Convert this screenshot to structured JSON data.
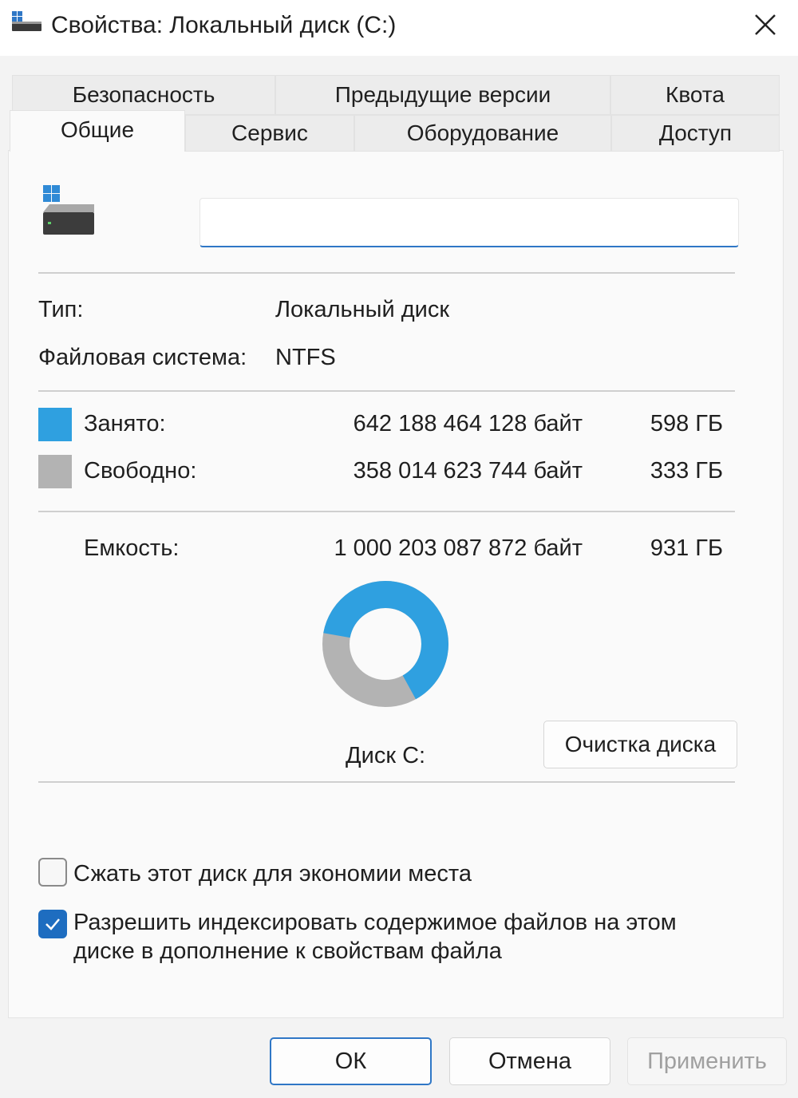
{
  "window": {
    "title": "Свойства: Локальный диск (C:)",
    "close_icon": "close-icon",
    "title_icon": "drive-icon"
  },
  "tabs": {
    "row_top": [
      {
        "label": "Безопасность"
      },
      {
        "label": "Предыдущие версии"
      },
      {
        "label": "Квота"
      }
    ],
    "row_bottom": [
      {
        "label": "Общие",
        "active": true
      },
      {
        "label": "Сервис"
      },
      {
        "label": "Оборудование"
      },
      {
        "label": "Доступ"
      }
    ]
  },
  "general": {
    "drive_name_value": "",
    "type_label": "Тип:",
    "type_value": "Локальный диск",
    "fs_label": "Файловая система:",
    "fs_value": "NTFS",
    "used": {
      "label": "Занято:",
      "bytes": "642 188 464 128 байт",
      "size": "598 ГБ",
      "color": "#2fa0e0"
    },
    "free": {
      "label": "Свободно:",
      "bytes": "358 014 623 744 байт",
      "size": "333 ГБ",
      "color": "#b3b3b3"
    },
    "capacity": {
      "label": "Емкость:",
      "bytes": "1 000 203 087 872 байт",
      "size": "931 ГБ"
    },
    "used_fraction": 0.642,
    "disk_caption": "Диск C:",
    "cleanup_button": "Очистка диска",
    "compress_label": "Сжать этот диск для экономии места",
    "compress_checked": false,
    "index_label_line1": "Разрешить индексировать содержимое файлов на этом",
    "index_label_line2": "диске в дополнение к свойствам файла",
    "index_checked": true
  },
  "footer": {
    "ok": "ОК",
    "cancel": "Отмена",
    "apply": "Применить"
  },
  "colors": {
    "accent": "#1e6dc0",
    "used": "#2fa0e0",
    "free": "#b3b3b3"
  }
}
